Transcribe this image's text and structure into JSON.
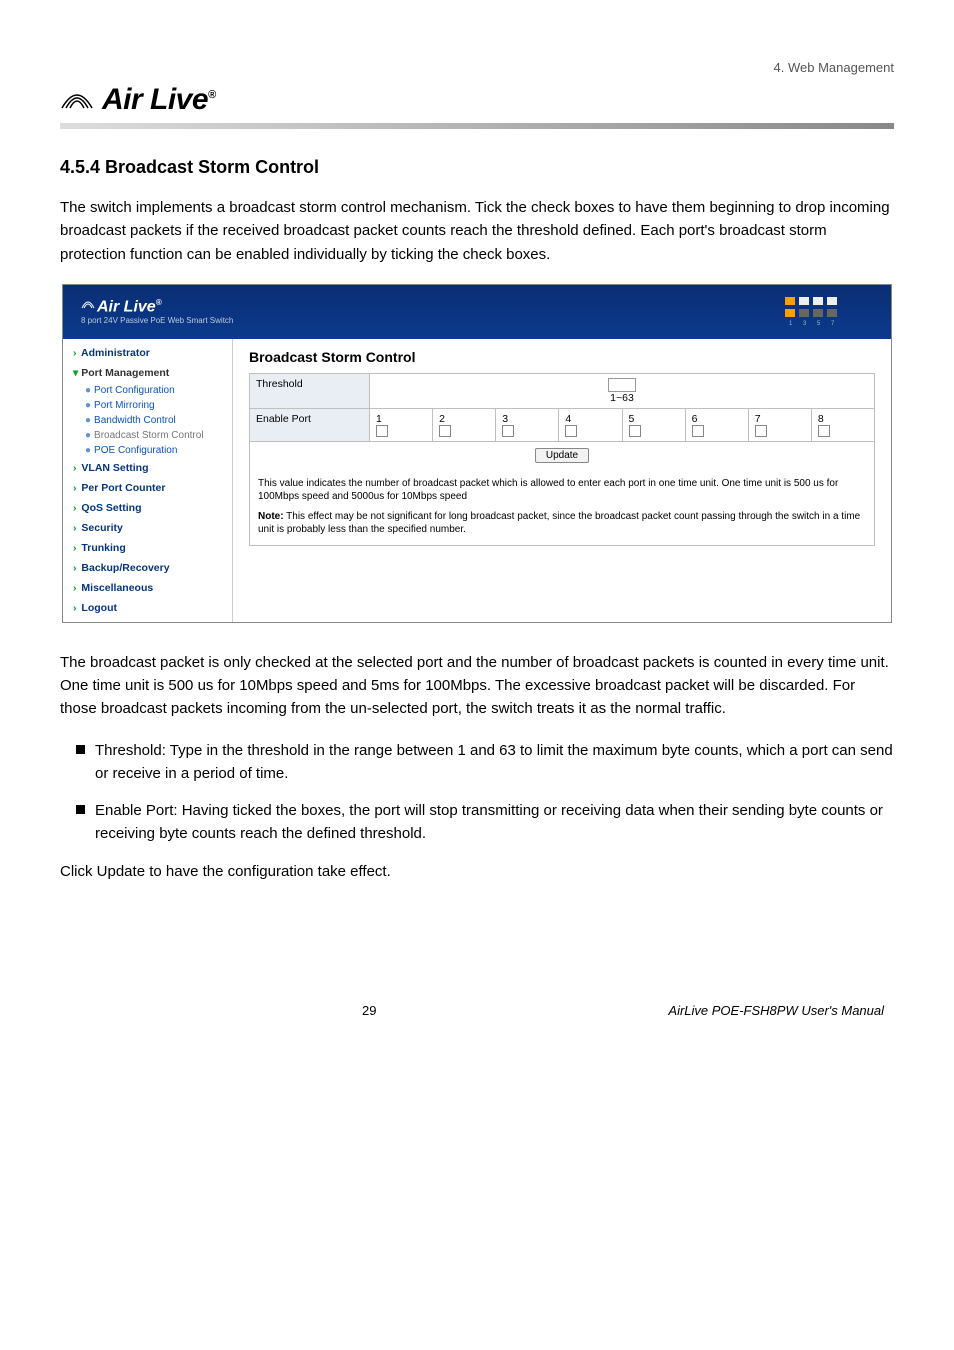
{
  "header": {
    "chapter": "4. Web Management",
    "brand": "Air Live",
    "reg": "®"
  },
  "section": {
    "title": "4.5.4 Broadcast Storm Control",
    "p1": "The switch implements a broadcast storm control mechanism. Tick the check boxes to have them beginning to drop incoming broadcast packets if the received broadcast packet counts reach the threshold defined. Each port's broadcast storm protection function can be enabled individually by ticking the check boxes.",
    "p2": "The broadcast packet is only checked at the selected port and the number of broadcast packets is counted in every time unit. One time unit is 500 us for 10Mbps speed and 5ms for 100Mbps. The excessive broadcast packet will be discarded. For those broadcast packets incoming from the un-selected port, the switch treats it as the normal traffic.",
    "b1": "Threshold: Type in the threshold in the range between 1 and 63 to limit the maximum byte counts, which a port can send or receive in a period of time.",
    "b2": "Enable Port: Having ticked the boxes, the port will stop transmitting or receiving data when their sending byte counts or receiving byte counts reach the defined threshold.",
    "p3": "Click Update to have the configuration take effect."
  },
  "shot": {
    "brand": "Air Live",
    "subtitle": "8 port 24V Passive PoE Web Smart Switch",
    "side": {
      "admin": "Administrator",
      "portmgmt": "Port Management",
      "items": {
        "pc": "Port Configuration",
        "pm": "Port Mirroring",
        "bc": "Bandwidth Control",
        "bs": "Broadcast Storm Control",
        "poe": "POE Configuration"
      },
      "vlan": "VLAN Setting",
      "ppc": "Per Port Counter",
      "qos": "QoS Setting",
      "sec": "Security",
      "trunk": "Trunking",
      "br": "Backup/Recovery",
      "misc": "Miscellaneous",
      "logout": "Logout"
    },
    "main": {
      "heading": "Broadcast Storm Control",
      "threshold_label": "Threshold",
      "threshold_range": "1~63",
      "enable_label": "Enable Port",
      "ports": [
        "1",
        "2",
        "3",
        "4",
        "5",
        "6",
        "7",
        "8"
      ],
      "update": "Update",
      "note_p1": "This value indicates the number of broadcast packet which is allowed to enter each port in one time unit. One time unit is 500 us for 100Mbps speed and 5000us for 10Mbps speed",
      "note_p2_label": "Note:",
      "note_p2": " This effect may be not significant for long broadcast packet, since the broadcast packet count passing through the switch in a time unit is probably less than the specified number."
    }
  },
  "footer": {
    "page": "29",
    "manual": "AirLive POE-FSH8PW User's Manual"
  }
}
